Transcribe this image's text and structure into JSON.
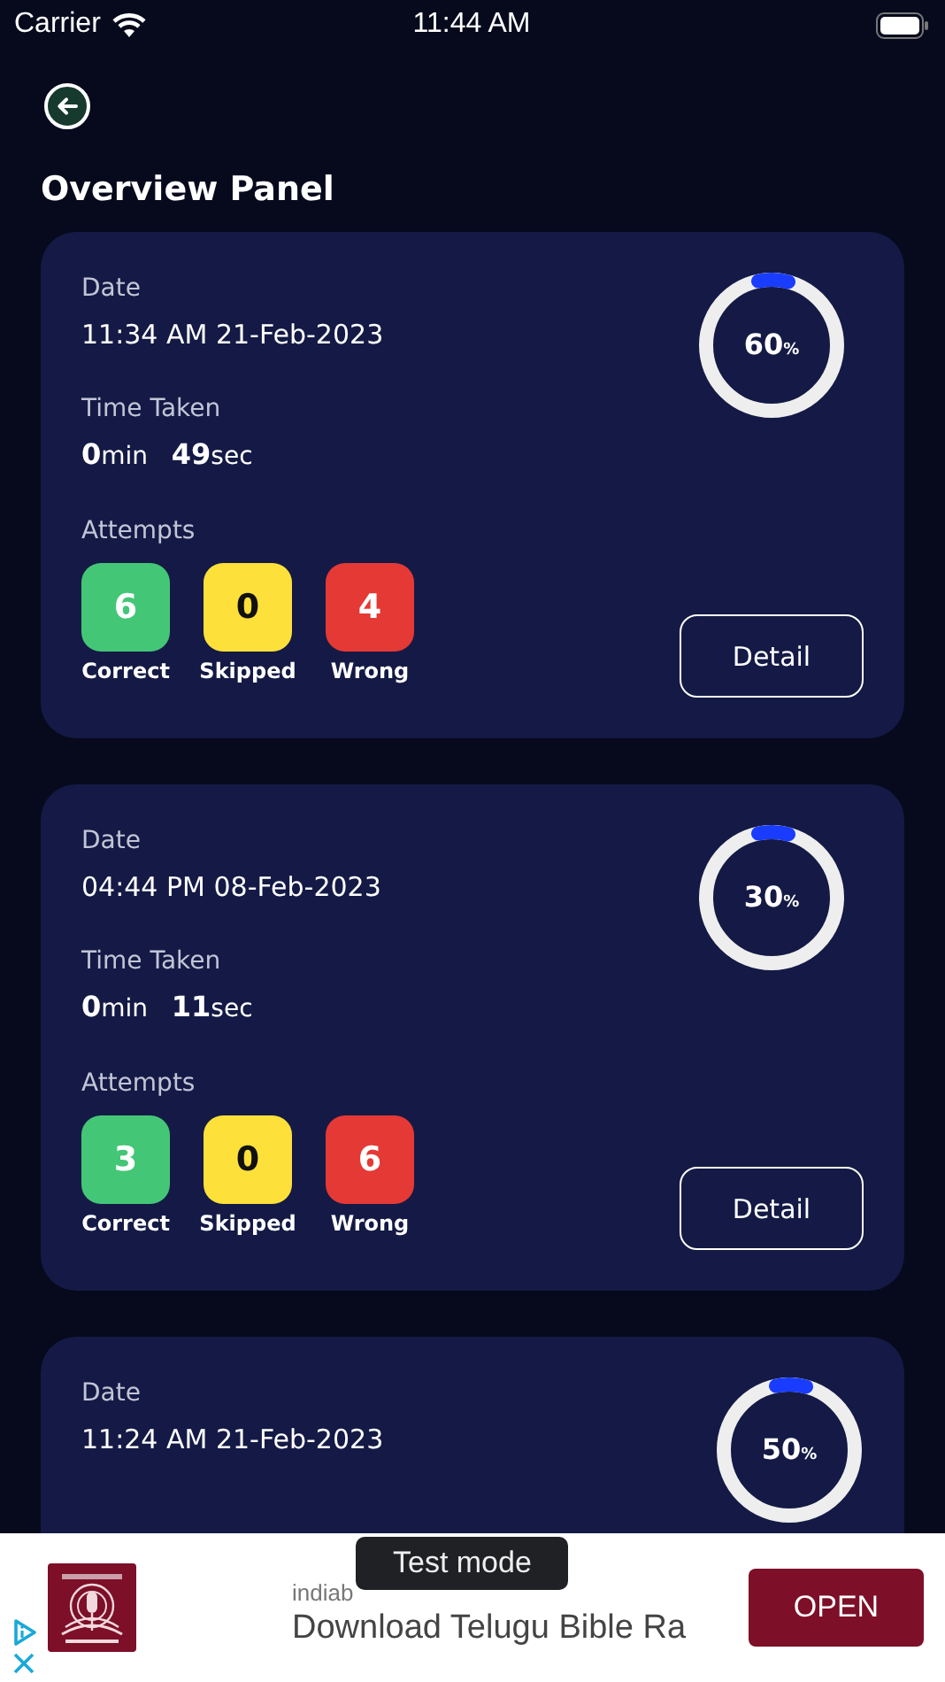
{
  "status_bar": {
    "carrier": "Carrier",
    "time": "11:44 AM"
  },
  "title": "Overview Panel",
  "sessions": [
    {
      "date_label": "Date",
      "date": "11:34 AM 21-Feb-2023",
      "time_label": "Time Taken",
      "minutes": "0",
      "min_unit": "min",
      "seconds": "49",
      "sec_unit": "sec",
      "percent": "60",
      "percent_sign": "%",
      "attempts_label": "Attempts",
      "attempts": [
        {
          "kind": "correct",
          "count": "6",
          "label": "Correct",
          "color": "#44c677"
        },
        {
          "kind": "skipped",
          "count": "0",
          "label": "Skipped",
          "color": "#fde03a"
        },
        {
          "kind": "wrong",
          "count": "4",
          "label": "Wrong",
          "color": "#e53935"
        }
      ],
      "button": "Detail"
    },
    {
      "date_label": "Date",
      "date": "04:44 PM 08-Feb-2023",
      "time_label": "Time Taken",
      "minutes": "0",
      "min_unit": "min",
      "seconds": "11",
      "sec_unit": "sec",
      "percent": "30",
      "percent_sign": "%",
      "attempts_label": "Attempts",
      "attempts": [
        {
          "kind": "correct",
          "count": "3",
          "label": "Correct",
          "color": "#44c677"
        },
        {
          "kind": "skipped",
          "count": "0",
          "label": "Skipped",
          "color": "#fde03a"
        },
        {
          "kind": "wrong",
          "count": "6",
          "label": "Wrong",
          "color": "#e53935"
        }
      ],
      "button": "Detail"
    },
    {
      "date_label": "Date",
      "date": "11:24 AM 21-Feb-2023",
      "percent": "50",
      "percent_sign": "%"
    }
  ],
  "ad": {
    "advertiser": "indiab",
    "headline": "Download Telugu Bible Ra",
    "button": "OPEN",
    "toast": "Test mode"
  }
}
